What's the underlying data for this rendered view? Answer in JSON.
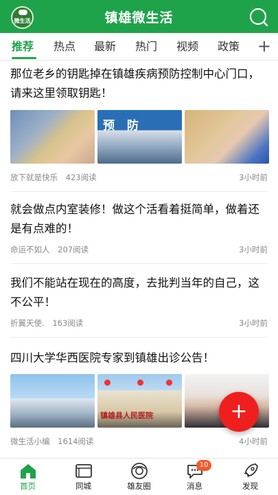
{
  "header": {
    "logo_text": "微生活",
    "title": "镇雄微生活"
  },
  "tabs": [
    {
      "label": "推荐",
      "active": true
    },
    {
      "label": "热点"
    },
    {
      "label": "最新"
    },
    {
      "label": "热门"
    },
    {
      "label": "视频"
    },
    {
      "label": "政策"
    }
  ],
  "tabs_more": "+",
  "articles": [
    {
      "title": "那位老乡的钥匙掉在镇雄疾病预防控制中心门口，请来这里领取钥匙！",
      "source": "放下就是快乐",
      "reads": "423阅读",
      "time": "3小时前",
      "images": [
        "key-photo-1",
        "sign-photo",
        "key-photo-2"
      ],
      "sign_text": "预 防"
    },
    {
      "title": "就会做点内室装修！做这个活看着挺简单，做着还是有点难的！",
      "source": "命运不如人",
      "reads": "207阅读",
      "time": "3小时前"
    },
    {
      "title": "我们不能站在现在的高度，去批判当年的自己，这不公平！",
      "source": "折翼天使.",
      "reads": "163阅读",
      "time": "3小时前"
    },
    {
      "title": "四川大学华西医院专家到镇雄出诊公告！",
      "source": "微生活小编",
      "reads": "1614阅读",
      "time": "4小时前",
      "images": [
        "hospital-photo-1",
        "hospital-photo-2",
        "doctor-photo"
      ],
      "hospital_text": "镇雄县人民医院"
    }
  ],
  "fab": {
    "label": "+",
    "color": "#f01f1f"
  },
  "bottom_nav": [
    {
      "label": "首页",
      "icon": "home-icon",
      "active": true
    },
    {
      "label": "同城",
      "icon": "folder-icon"
    },
    {
      "label": "雄友圈",
      "icon": "camera-lens-icon"
    },
    {
      "label": "消息",
      "icon": "chat-icon",
      "badge": "10"
    },
    {
      "label": "发现",
      "icon": "rocket-icon"
    }
  ],
  "colors": {
    "brand": "#1fa34a",
    "badge": "#f25a2a",
    "meta_text": "#888888"
  }
}
